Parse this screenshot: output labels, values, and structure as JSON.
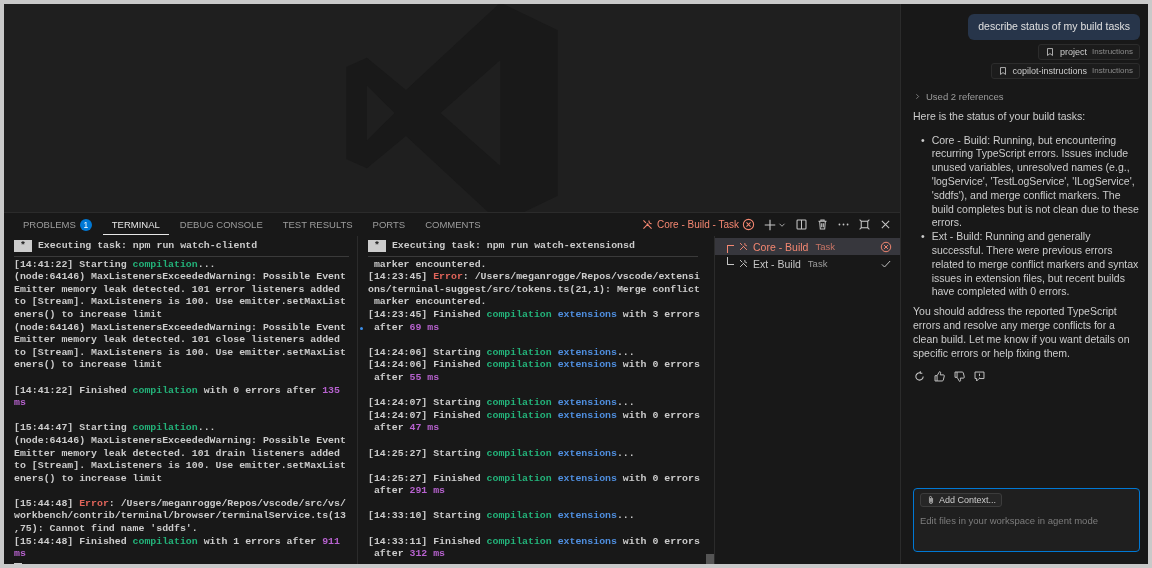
{
  "panel": {
    "tabs": [
      {
        "label": "PROBLEMS",
        "badge": "1",
        "selected": false
      },
      {
        "label": "TERMINAL",
        "selected": true
      },
      {
        "label": "DEBUG CONSOLE",
        "selected": false
      },
      {
        "label": "TEST RESULTS",
        "selected": false
      },
      {
        "label": "PORTS",
        "selected": false
      },
      {
        "label": "COMMENTS",
        "selected": false
      }
    ],
    "active_task": {
      "label": "Core - Build - Task",
      "kind": "error"
    },
    "terminals": [
      {
        "header_mark": "*",
        "header": "Executing task: npm run watch-clientd",
        "cursor": true,
        "lines": [
          {
            "s": [
              "[14:41:22] Starting ",
              {
                "text": "compilation",
                "kind": "task"
              },
              "..."
            ]
          },
          {
            "s": [
              "(node:64146) MaxListenersExceededWarning: Possible Event"
            ]
          },
          {
            "s": [
              "Emitter memory leak detected. 101 error listeners added"
            ]
          },
          {
            "s": [
              "to [Stream]. MaxListeners is 100. Use emitter.setMaxList"
            ]
          },
          {
            "s": [
              "eners() to increase limit"
            ]
          },
          {
            "s": [
              "(node:64146) MaxListenersExceededWarning: Possible Event"
            ]
          },
          {
            "s": [
              "Emitter memory leak detected. 101 close listeners added"
            ]
          },
          {
            "s": [
              "to [Stream]. MaxListeners is 100. Use emitter.setMaxList"
            ]
          },
          {
            "s": [
              "eners() to increase limit"
            ]
          },
          {
            "kind": "blank"
          },
          {
            "s": [
              "[14:41:22] Finished ",
              {
                "text": "compilation",
                "kind": "task"
              },
              " with 0 errors after ",
              {
                "text": "135",
                "kind": "number"
              }
            ]
          },
          {
            "s": [
              {
                "text": "ms",
                "kind": "number"
              }
            ]
          },
          {
            "kind": "blank"
          },
          {
            "s": [
              "[15:44:47] Starting ",
              {
                "text": "compilation",
                "kind": "task"
              },
              "..."
            ]
          },
          {
            "s": [
              "(node:64146) MaxListenersExceededWarning: Possible Event"
            ]
          },
          {
            "s": [
              "Emitter memory leak detected. 101 drain listeners added"
            ]
          },
          {
            "s": [
              "to [Stream]. MaxListeners is 100. Use emitter.setMaxList"
            ]
          },
          {
            "s": [
              "eners() to increase limit"
            ]
          },
          {
            "kind": "blank"
          },
          {
            "s": [
              "[15:44:48] ",
              {
                "text": "Error",
                "kind": "error"
              },
              ": /Users/meganrogge/Repos/vscode/src/vs/"
            ]
          },
          {
            "s": [
              "workbench/contrib/terminal/browser/terminalService.ts(13"
            ]
          },
          {
            "s": [
              ",75): Cannot find name 'sddfs'."
            ]
          },
          {
            "s": [
              "[15:44:48] Finished ",
              {
                "text": "compilation",
                "kind": "task"
              },
              " with 1 errors after ",
              {
                "text": "911",
                "kind": "number"
              }
            ]
          },
          {
            "s": [
              {
                "text": "ms",
                "kind": "number"
              }
            ]
          }
        ]
      },
      {
        "header_mark": "*",
        "header": "Executing task: npm run watch-extensionsd",
        "lines": [
          {
            "s": [
              " marker encountered."
            ]
          },
          {
            "s": [
              "[14:23:45] ",
              {
                "text": "Error",
                "kind": "error"
              },
              ": /Users/meganrogge/Repos/vscode/extensi"
            ]
          },
          {
            "s": [
              "ons/terminal-suggest/src/tokens.ts(21,1): Merge conflict"
            ]
          },
          {
            "s": [
              " marker encountered."
            ]
          },
          {
            "s": [
              "[14:23:45] Finished ",
              {
                "text": "compilation",
                "kind": "task"
              },
              {
                "text": " extensions",
                "kind": "scope"
              },
              " with 3 errors"
            ]
          },
          {
            "marker": true,
            "s": [
              " after ",
              {
                "text": "69 ms",
                "kind": "number"
              }
            ]
          },
          {
            "kind": "blank"
          },
          {
            "s": [
              "[14:24:06] Starting ",
              {
                "text": "compilation",
                "kind": "task"
              },
              {
                "text": " extensions",
                "kind": "scope"
              },
              "..."
            ]
          },
          {
            "s": [
              "[14:24:06] Finished ",
              {
                "text": "compilation",
                "kind": "task"
              },
              {
                "text": " extensions",
                "kind": "scope"
              },
              " with 0 errors"
            ]
          },
          {
            "s": [
              " after ",
              {
                "text": "55 ms",
                "kind": "number"
              }
            ]
          },
          {
            "kind": "blank"
          },
          {
            "s": [
              "[14:24:07] Starting ",
              {
                "text": "compilation",
                "kind": "task"
              },
              {
                "text": " extensions",
                "kind": "scope"
              },
              "..."
            ]
          },
          {
            "s": [
              "[14:24:07] Finished ",
              {
                "text": "compilation",
                "kind": "task"
              },
              {
                "text": " extensions",
                "kind": "scope"
              },
              " with 0 errors"
            ]
          },
          {
            "s": [
              " after ",
              {
                "text": "47 ms",
                "kind": "number"
              }
            ]
          },
          {
            "kind": "blank"
          },
          {
            "s": [
              "[14:25:27] Starting ",
              {
                "text": "compilation",
                "kind": "task"
              },
              {
                "text": " extensions",
                "kind": "scope"
              },
              "..."
            ]
          },
          {
            "kind": "blank"
          },
          {
            "s": [
              "[14:25:27] Finished ",
              {
                "text": "compilation",
                "kind": "task"
              },
              {
                "text": " extensions",
                "kind": "scope"
              },
              " with 0 errors"
            ]
          },
          {
            "s": [
              " after ",
              {
                "text": "291 ms",
                "kind": "number"
              }
            ]
          },
          {
            "kind": "blank"
          },
          {
            "s": [
              "[14:33:10] Starting ",
              {
                "text": "compilation",
                "kind": "task"
              },
              {
                "text": " extensions",
                "kind": "scope"
              },
              "..."
            ]
          },
          {
            "kind": "blank"
          },
          {
            "s": [
              "[14:33:11] Finished ",
              {
                "text": "compilation",
                "kind": "task"
              },
              {
                "text": " extensions",
                "kind": "scope"
              },
              " with 0 errors"
            ]
          },
          {
            "s": [
              " after ",
              {
                "text": "312 ms",
                "kind": "number"
              }
            ]
          }
        ]
      }
    ],
    "tasks": [
      {
        "name": "Core - Build",
        "tag": "Task",
        "kind": "error",
        "selected": true
      },
      {
        "name": "Ext - Build",
        "tag": "Task",
        "kind": "success",
        "selected": false
      }
    ]
  },
  "chat": {
    "request": "describe status of my build tasks",
    "references": [
      {
        "name": "project",
        "tag": "Instructions"
      },
      {
        "name": "copilot-instructions",
        "tag": "Instructions"
      }
    ],
    "used_references": {
      "label": "Used 2 references",
      "expanded": false
    },
    "intro": "Here is the status of your build tasks:",
    "bullets": [
      {
        "marker": "•",
        "text": "Core - Build: Running, but encountering recurring TypeScript errors. Issues include unused variables, unresolved names (e.g., 'logService', 'TestLogService', 'ILogService', 'sddfs'), and merge conflict markers. The build completes but is not clean due to these errors."
      },
      {
        "marker": "•",
        "text": "Ext - Build: Running and generally successful. There were previous errors related to merge conflict markers and syntax issues in extension files, but recent builds have completed with 0 errors."
      }
    ],
    "closing": "You should address the reported TypeScript errors and resolve any merge conflicts for a clean build. Let me know if you want details on specific errors or help fixing them.",
    "input": {
      "button": "Add Context...",
      "placeholder": "Edit files in your workspace in agent mode"
    }
  }
}
